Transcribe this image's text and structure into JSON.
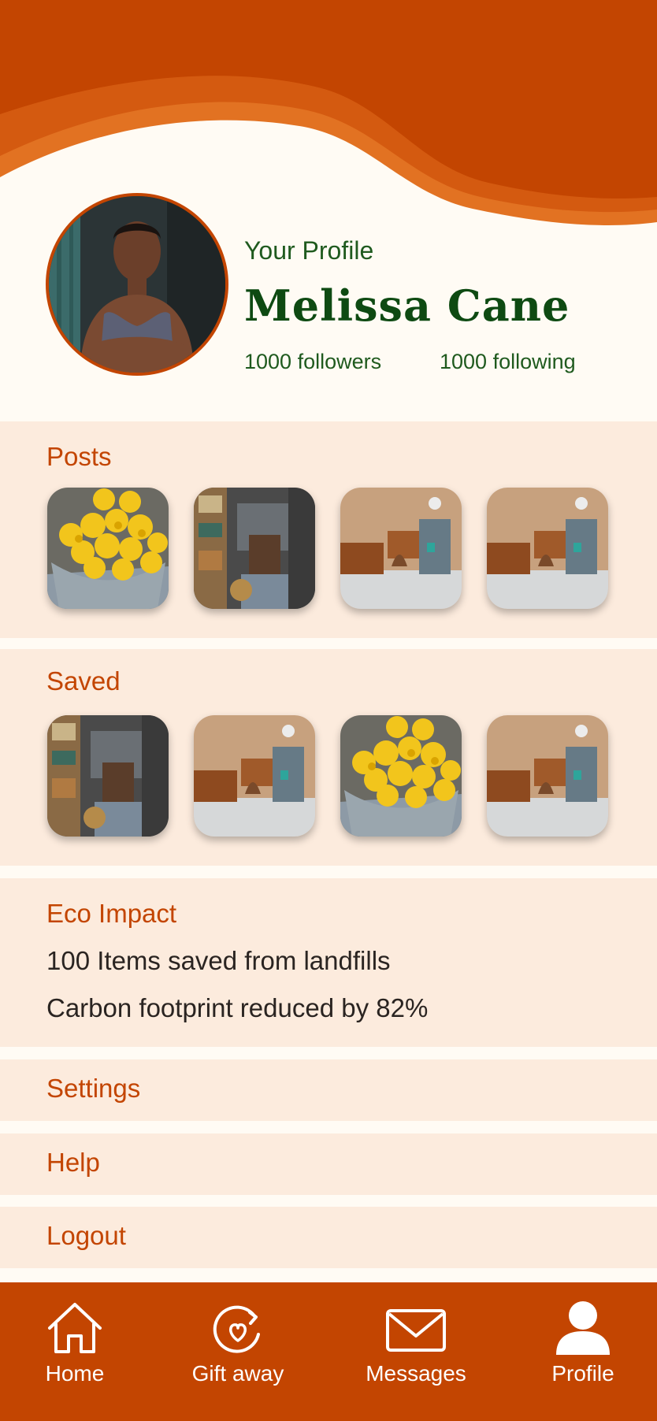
{
  "profile": {
    "heading": "Your Profile",
    "name": "Melissa Cane",
    "followers": "1000 followers",
    "following": "1000 following"
  },
  "posts": {
    "title": "Posts",
    "items": [
      {
        "image": "lemons-basket"
      },
      {
        "image": "shop-aisle"
      },
      {
        "image": "room-interior"
      },
      {
        "image": "room-interior"
      }
    ]
  },
  "saved": {
    "title": "Saved",
    "items": [
      {
        "image": "shop-aisle"
      },
      {
        "image": "room-interior"
      },
      {
        "image": "lemons-basket"
      },
      {
        "image": "room-interior"
      }
    ]
  },
  "eco": {
    "title": "Eco Impact",
    "line1": "100 Items saved from landfills",
    "line2": "Carbon footprint reduced by 82%"
  },
  "menu": {
    "settings": "Settings",
    "help": "Help",
    "logout": "Logout"
  },
  "nav": {
    "home": "Home",
    "gift": "Gift away",
    "messages": "Messages",
    "profile": "Profile",
    "icons": [
      "home-icon",
      "gift-away-icon",
      "envelope-icon",
      "person-icon"
    ]
  },
  "colors": {
    "accent": "#C34501",
    "accent_light": "#E27222",
    "card_bg": "#FCEBDD",
    "page_bg": "#FFFBF4",
    "name_green": "#0E4A12"
  }
}
